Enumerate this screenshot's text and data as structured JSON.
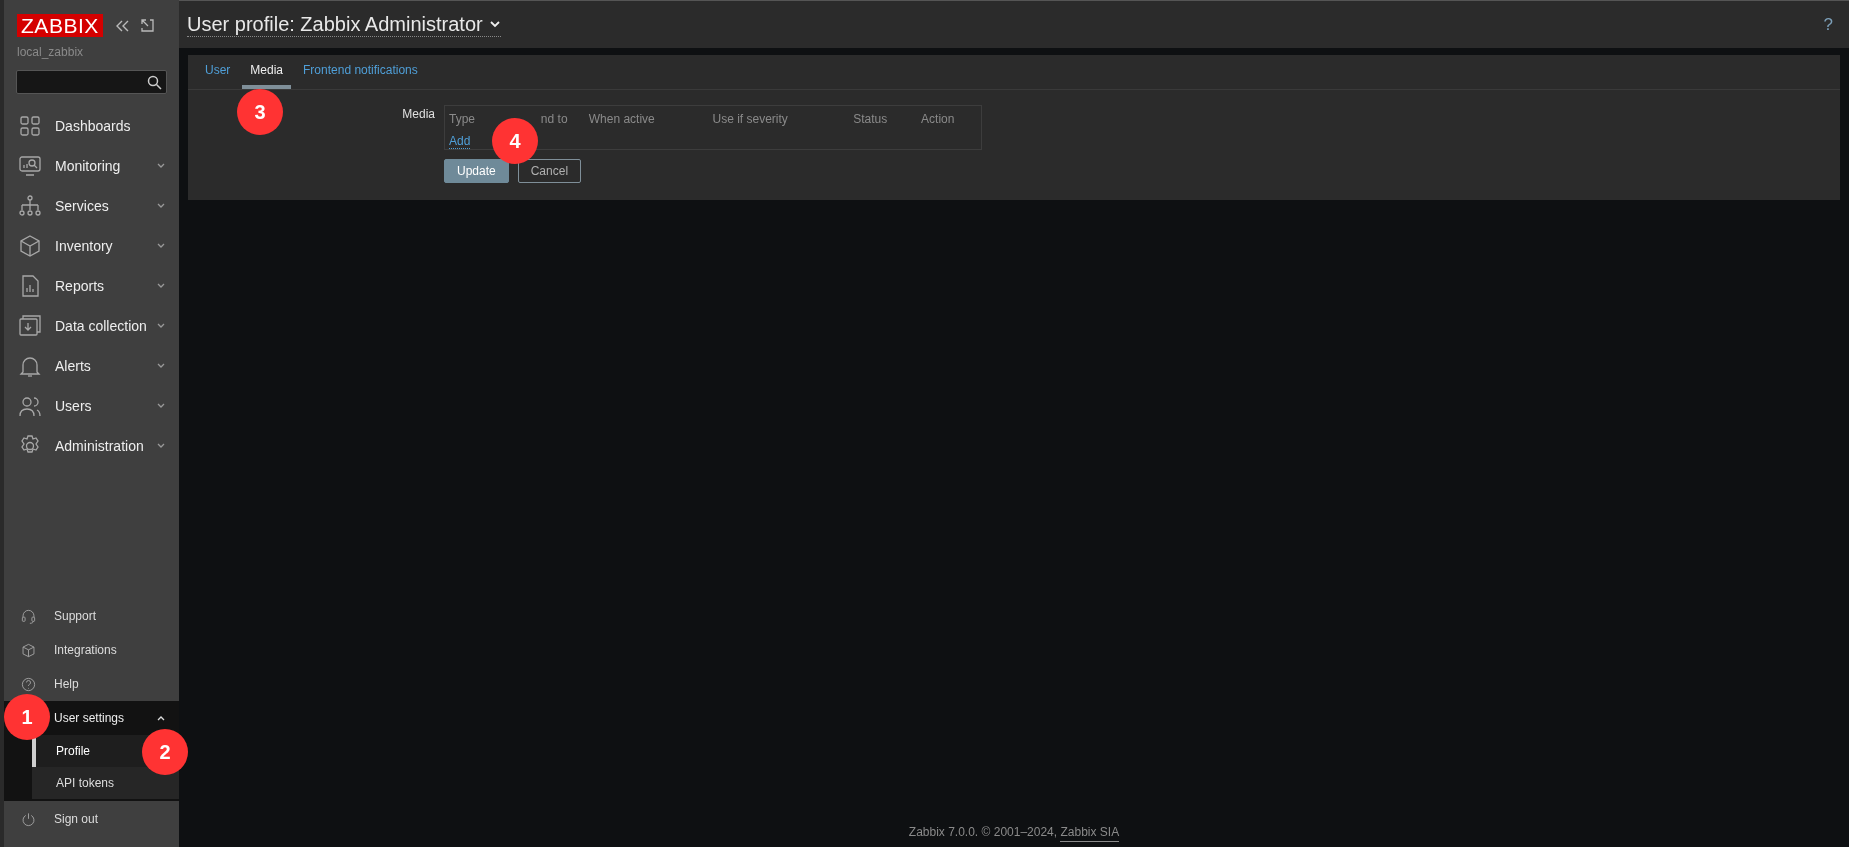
{
  "sidebar": {
    "logo": "ZABBIX",
    "server_name": "local_zabbix",
    "menu": [
      {
        "label": "Dashboards",
        "expandable": false
      },
      {
        "label": "Monitoring",
        "expandable": true
      },
      {
        "label": "Services",
        "expandable": true
      },
      {
        "label": "Inventory",
        "expandable": true
      },
      {
        "label": "Reports",
        "expandable": true
      },
      {
        "label": "Data collection",
        "expandable": true
      },
      {
        "label": "Alerts",
        "expandable": true
      },
      {
        "label": "Users",
        "expandable": true
      },
      {
        "label": "Administration",
        "expandable": true
      }
    ],
    "footer_menu": [
      "Support",
      "Integrations",
      "Help"
    ],
    "user_settings": {
      "label": "User settings",
      "expanded": true,
      "children": [
        {
          "label": "Profile",
          "selected": true
        },
        {
          "label": "API tokens",
          "selected": false
        }
      ]
    },
    "sign_out": "Sign out"
  },
  "header": {
    "title": "User profile: Zabbix Administrator",
    "help": "?"
  },
  "tabs": [
    {
      "label": "User",
      "selected": false
    },
    {
      "label": "Media",
      "selected": true
    },
    {
      "label": "Frontend notifications",
      "selected": false
    }
  ],
  "form": {
    "label": "Media",
    "columns": [
      "Type",
      "nd to",
      "When active",
      "Use if severity",
      "Status",
      "Action"
    ],
    "add_link": "Add",
    "buttons": [
      {
        "label": "Update",
        "kind": "primary"
      },
      {
        "label": "Cancel",
        "kind": "secondary"
      }
    ]
  },
  "footer": {
    "text": "Zabbix 7.0.0. © 2001–2024, ",
    "link": "Zabbix SIA"
  },
  "callouts": [
    "1",
    "2",
    "3",
    "4"
  ]
}
